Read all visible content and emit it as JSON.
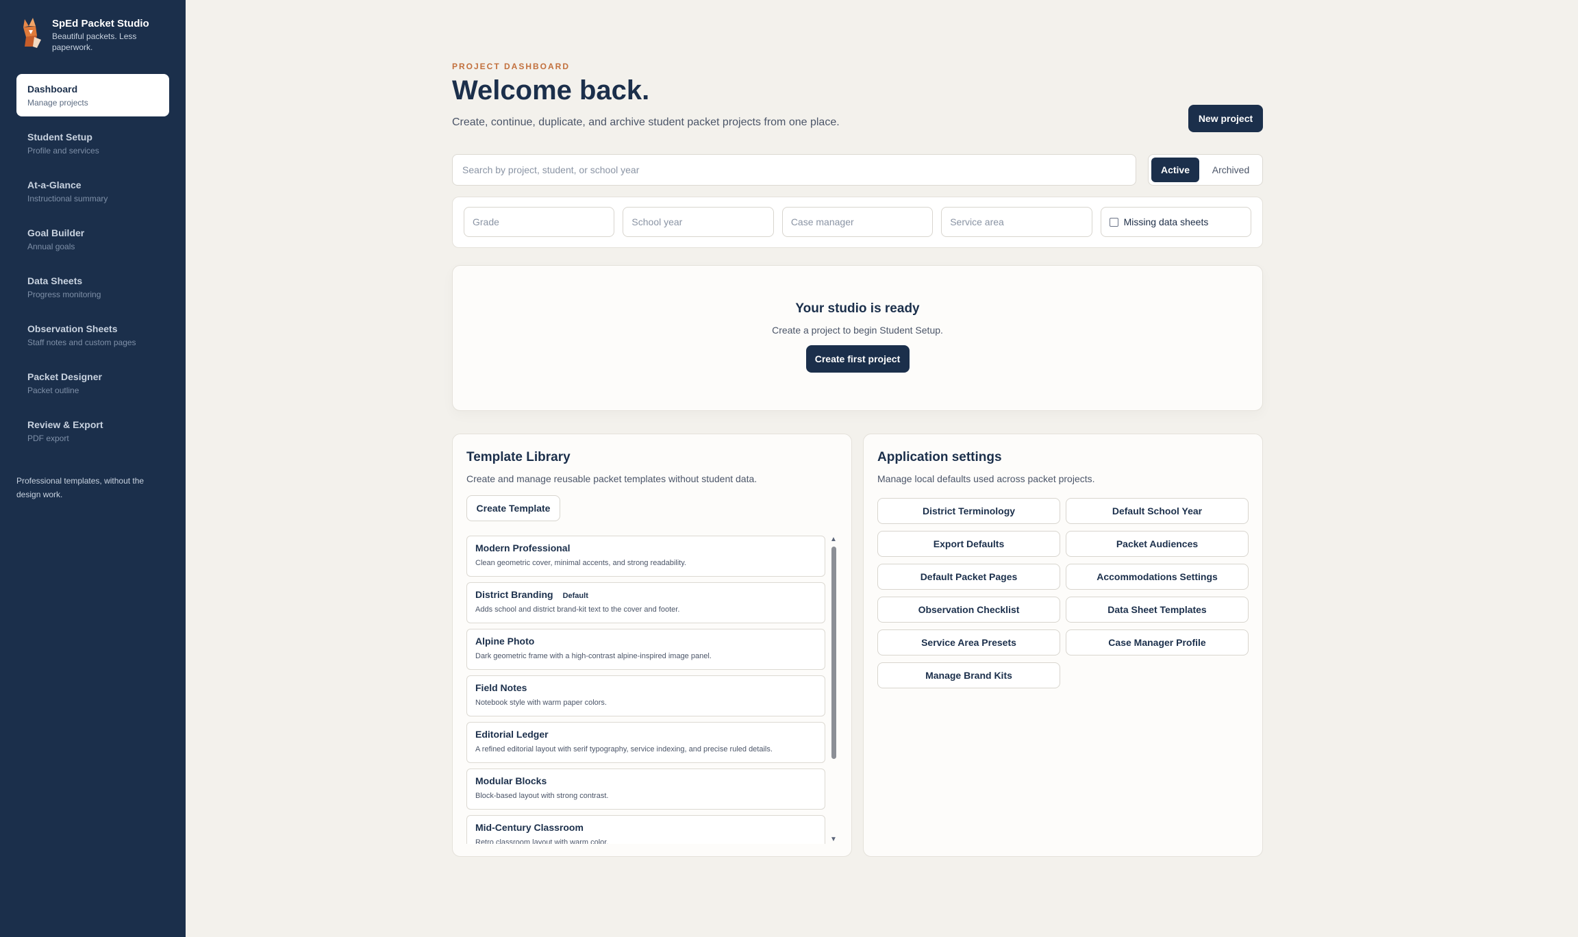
{
  "app": {
    "name": "SpEd Packet Studio",
    "tagline": "Beautiful packets. Less paperwork.",
    "footer": "Professional templates, without the design work."
  },
  "nav": [
    {
      "label": "Dashboard",
      "sub": "Manage projects",
      "active": true
    },
    {
      "label": "Student Setup",
      "sub": "Profile and services"
    },
    {
      "label": "At-a-Glance",
      "sub": "Instructional summary"
    },
    {
      "label": "Goal Builder",
      "sub": "Annual goals"
    },
    {
      "label": "Data Sheets",
      "sub": "Progress monitoring"
    },
    {
      "label": "Observation Sheets",
      "sub": "Staff notes and custom pages"
    },
    {
      "label": "Packet Designer",
      "sub": "Packet outline"
    },
    {
      "label": "Review & Export",
      "sub": "PDF export"
    }
  ],
  "header": {
    "eyebrow": "PROJECT DASHBOARD",
    "title": "Welcome back.",
    "subtitle": "Create, continue, duplicate, and archive student packet projects from one place.",
    "new_project": "New project"
  },
  "search": {
    "placeholder": "Search by project, student, or school year",
    "value": ""
  },
  "status_toggle": {
    "active": "Active",
    "archived": "Archived"
  },
  "filters": {
    "grade": "Grade",
    "school_year": "School year",
    "case_manager": "Case manager",
    "service_area": "Service area",
    "missing_data_sheets": "Missing data sheets"
  },
  "empty_state": {
    "title": "Your studio is ready",
    "subtitle": "Create a project to begin Student Setup.",
    "button": "Create first project"
  },
  "template_library": {
    "title": "Template Library",
    "subtitle": "Create and manage reusable packet templates without student data.",
    "create_button": "Create Template",
    "items": [
      {
        "name": "Modern Professional",
        "desc": "Clean geometric cover, minimal accents, and strong readability.",
        "badge": ""
      },
      {
        "name": "District Branding",
        "desc": "Adds school and district brand-kit text to the cover and footer.",
        "badge": "Default"
      },
      {
        "name": "Alpine Photo",
        "desc": "Dark geometric frame with a high-contrast alpine-inspired image panel.",
        "badge": ""
      },
      {
        "name": "Field Notes",
        "desc": "Notebook style with warm paper colors.",
        "badge": ""
      },
      {
        "name": "Editorial Ledger",
        "desc": "A refined editorial layout with serif typography, service indexing, and precise ruled details.",
        "badge": ""
      },
      {
        "name": "Modular Blocks",
        "desc": "Block-based layout with strong contrast.",
        "badge": ""
      },
      {
        "name": "Mid-Century Classroom",
        "desc": "Retro classroom layout with warm color.",
        "badge": ""
      }
    ]
  },
  "app_settings": {
    "title": "Application settings",
    "subtitle": "Manage local defaults used across packet projects.",
    "buttons": [
      "District Terminology",
      "Default School Year",
      "Export Defaults",
      "Packet Audiences",
      "Default Packet Pages",
      "Accommodations Settings",
      "Observation Checklist",
      "Data Sheet Templates",
      "Service Area Presets",
      "Case Manager Profile",
      "Manage Brand Kits"
    ]
  },
  "colors": {
    "sidebar": "#1b2f4b",
    "accent": "#c2703d",
    "background": "#f3f1ec"
  }
}
